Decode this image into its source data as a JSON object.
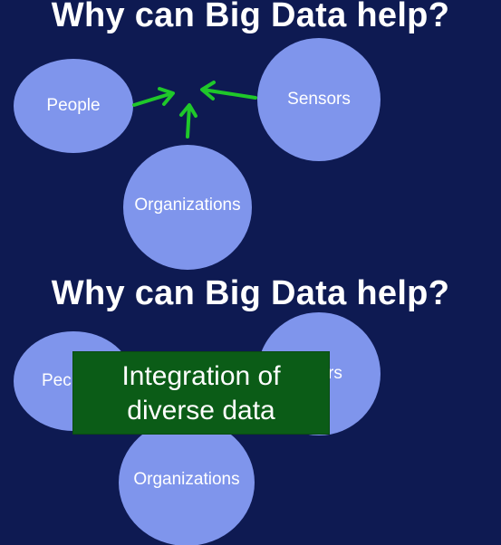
{
  "slide_top": {
    "title": "Why can Big Data help?",
    "nodes": {
      "people": "People",
      "sensors": "Sensors",
      "organizations": "Organizations"
    }
  },
  "slide_bottom": {
    "title": "Why can Big Data help?",
    "nodes": {
      "people_partial": "Pec",
      "sensors_partial": "rs",
      "organizations": "Organizations"
    },
    "overlay": {
      "line1": "Integration of",
      "line2": "diverse data"
    }
  },
  "colors": {
    "background": "#0e1a52",
    "node": "#7f95ec",
    "arrow": "#1fc82a",
    "overlay": "#0b5c17"
  }
}
